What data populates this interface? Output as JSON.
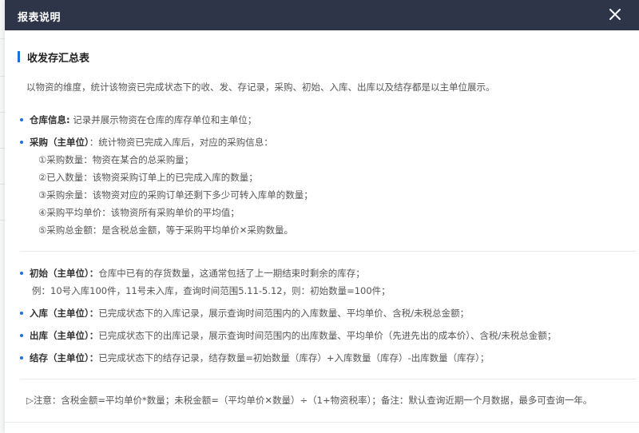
{
  "dialog": {
    "title": "报表说明",
    "close_icon": "close-icon"
  },
  "section": {
    "title": "收发存汇总表",
    "intro": "以物资的维度，统计该物资已完成状态下的收、发、存记录，采购、初始、入库、出库以及结存都是以主单位展示。"
  },
  "warehouse": {
    "label": "仓库信息:",
    "text": " 记录并展示物资在仓库的库存单位和主单位；"
  },
  "purchase": {
    "label": "采购（主单位）",
    "text": "：统计物资已完成入库后，对应的采购信息：",
    "items": [
      "①采购数量：物资在某合的总采购量；",
      "②已入数量：该物资采购订单上的已完成入库的数量；",
      "③采购余量：该物资对应的采购订单还剩下多少可转入库单的数量；",
      "④采购平均单价：该物资所有采购单价的平均值；",
      "⑤采购总金额：是含税总金额，等于采购平均单价✕采购数量。"
    ]
  },
  "initial": {
    "label": "初始（主单位）：",
    "text": "仓库中已有的存货数量，这通常包括了上一期结束时剩余的库存；",
    "example": "例：10号入库100件，11号未入库，查询时间范围5.11-5.12，则：初始数量=100件；"
  },
  "inbound": {
    "label": "入库（主单位）：",
    "text": "已完成状态下的入库记录，展示查询时间范围内的入库数量、平均单价、含税/未税总金额；"
  },
  "outbound": {
    "label": "出库（主单位）：",
    "text": "已完成状态下的出库记录，展示查询时间范围内的出库数量、平均单价（先进先出的成本价）、含税/未税总金额；"
  },
  "balance": {
    "label": "结存（主单位）：",
    "text": "已完成状态下的结存记录，结存数量=初始数量（库存）+入库数量（库存）-出库数量（库存）；"
  },
  "note": "▷注意：含税金额=平均单价*数量；未税金额=（平均单价✕数量）÷（1+物资税率）；备注：默认查询近期一个月数据，最多可查询一年。",
  "colors": {
    "header_bg": "#2f3548",
    "accent": "#1e6fd9"
  }
}
